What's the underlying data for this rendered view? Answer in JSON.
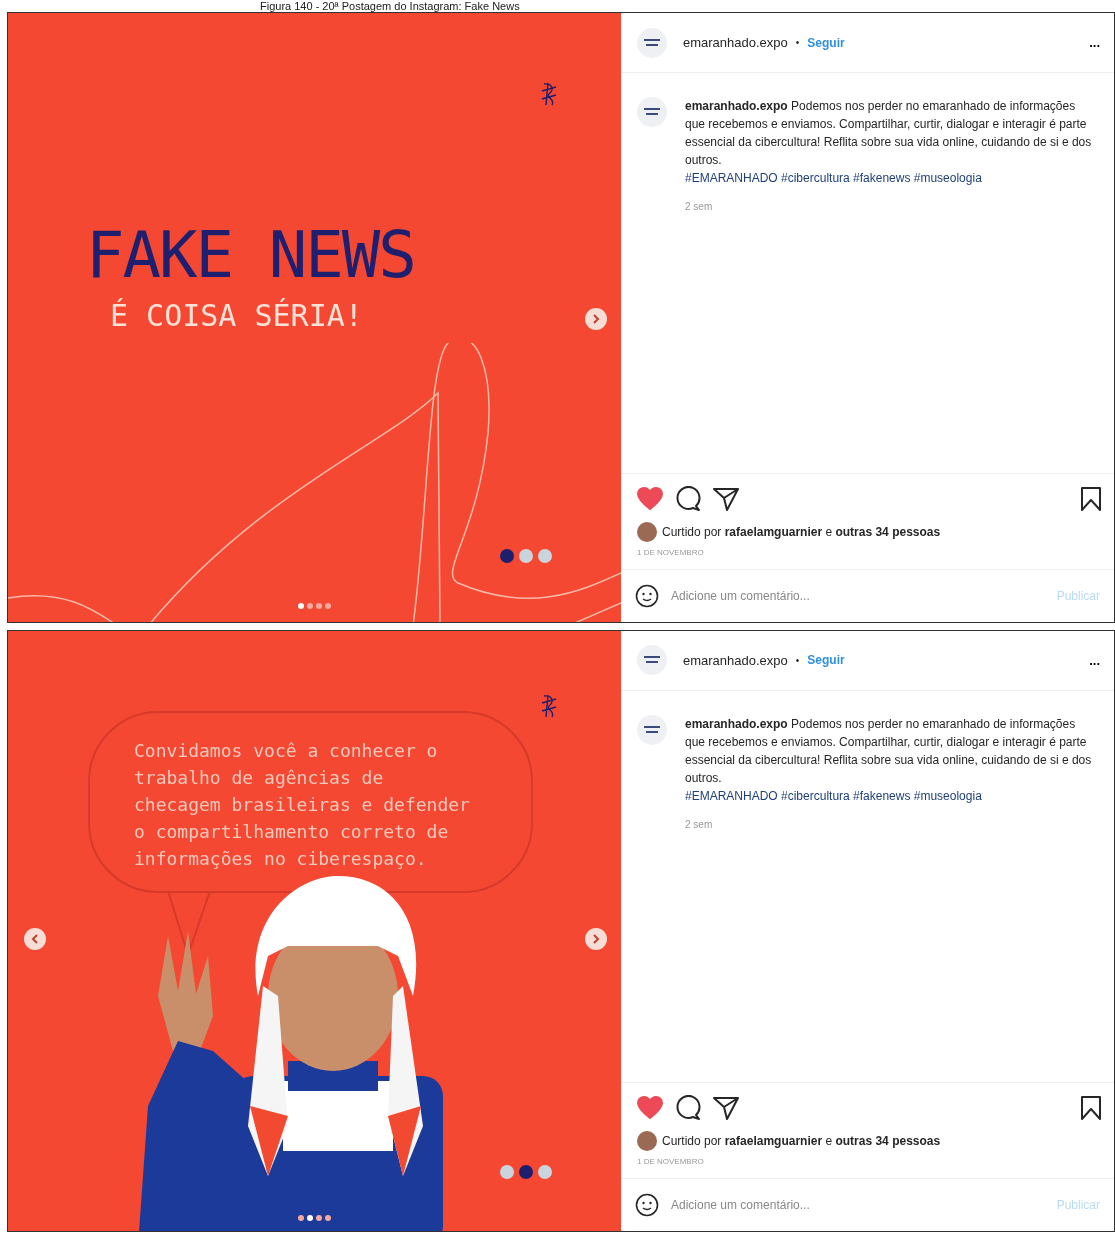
{
  "caption": "Figura 140 - 20ª Postagem do Instagram: Fake News",
  "posts": [
    {
      "slide": {
        "kind": "title",
        "title": "FAKE NEWS",
        "subtitle": "É COISA SÉRIA!"
      },
      "prev_arrow": false,
      "next_arrow": true,
      "slide_dots": [
        {
          "selected": true
        },
        {
          "selected": false
        },
        {
          "selected": false
        }
      ],
      "carousel_dots": [
        {
          "selected": true
        },
        {
          "selected": false
        },
        {
          "selected": false
        },
        {
          "selected": false
        }
      ],
      "username": "emaranhado.expo",
      "separator": "•",
      "follow": "Seguir",
      "more": "...",
      "description": "**emaranhado.expo** Podemos nos perder no emaranhado de informações que recebemos e enviamos. Compartilhar, curtir, dialogar e interagir é parte essencial da cibercultura! Reflita sobre sua vida online, cuidando de si e dos outros.",
      "hashtags": "#EMARANHADO #cibercultura #fakenews #museologia",
      "age": "2 sem",
      "liked": true,
      "saved": false,
      "likes": "Curtido por **rafaelamguarnier** e **outras 34 pessoas**",
      "date": "1 DE NOVEMBRO",
      "comment": {
        "placeholder": "Adicione um comentário..."
      },
      "publish": "Publicar"
    },
    {
      "slide": {
        "kind": "speech",
        "text": "Convidamos você a conhecer o trabalho de agências de checagem brasileiras e defender o compartilhamento correto de informações no ciberespaço."
      },
      "prev_arrow": true,
      "next_arrow": true,
      "slide_dots": [
        {
          "selected": false
        },
        {
          "selected": true
        },
        {
          "selected": false
        }
      ],
      "carousel_dots": [
        {
          "selected": false
        },
        {
          "selected": true
        },
        {
          "selected": false
        },
        {
          "selected": false
        }
      ],
      "username": "emaranhado.expo",
      "separator": "•",
      "follow": "Seguir",
      "more": "...",
      "description": "**emaranhado.expo** Podemos nos perder no emaranhado de informações que recebemos e enviamos. Compartilhar, curtir, dialogar e interagir é parte essencial da cibercultura! Reflita sobre sua vida online, cuidando de si e dos outros.",
      "hashtags": "#EMARANHADO #cibercultura #fakenews #museologia",
      "age": "2 sem",
      "liked": true,
      "saved": false,
      "likes": "Curtido por **rafaelamguarnier** e **outras 34 pessoas**",
      "date": "1 DE NOVEMBRO",
      "comment": {
        "placeholder": "Adicione um comentário..."
      },
      "publish": "Publicar"
    }
  ]
}
